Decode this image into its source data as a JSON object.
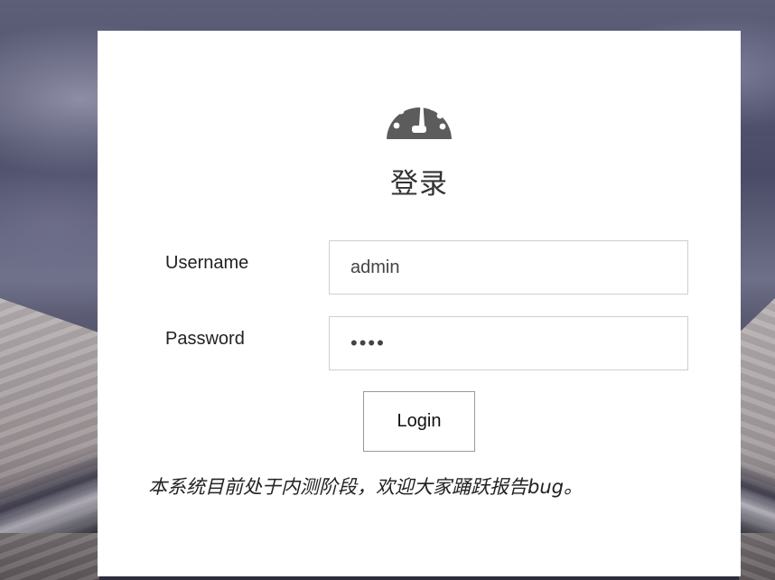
{
  "login": {
    "logo_icon": "dashboard-gauge-icon",
    "title": "登录",
    "username_label": "Username",
    "username_value": "admin",
    "password_label": "Password",
    "password_value": "••••",
    "login_button": "Login",
    "notice": "本系统目前处于内测阶段，欢迎大家踊跃报告bug。"
  },
  "colors": {
    "logo": "#5c5c5c",
    "card_background": "#ffffff",
    "text": "#222222"
  }
}
